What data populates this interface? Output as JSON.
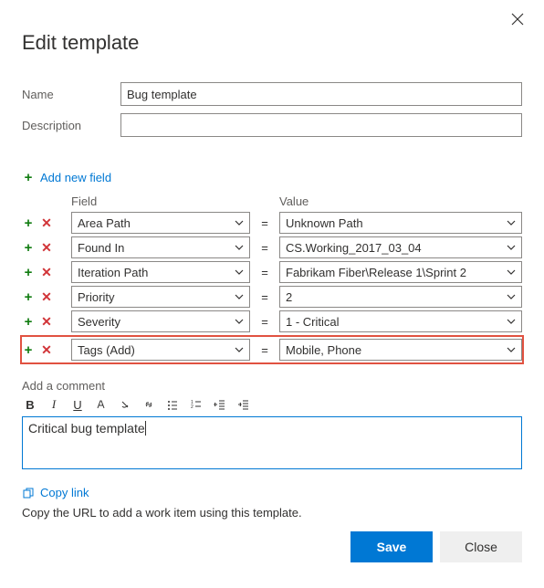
{
  "dialog": {
    "title": "Edit template",
    "nameLabel": "Name",
    "nameValue": "Bug template",
    "descLabel": "Description",
    "descValue": ""
  },
  "addFieldLabel": "Add new field",
  "headers": {
    "field": "Field",
    "value": "Value"
  },
  "rows": [
    {
      "field": "Area Path",
      "value": "Unknown Path",
      "highlighted": false
    },
    {
      "field": "Found In",
      "value": "CS.Working_2017_03_04",
      "highlighted": false
    },
    {
      "field": "Iteration Path",
      "value": "Fabrikam Fiber\\Release 1\\Sprint 2",
      "highlighted": false
    },
    {
      "field": "Priority",
      "value": "2",
      "highlighted": false
    },
    {
      "field": "Severity",
      "value": "1 - Critical",
      "highlighted": false
    },
    {
      "field": "Tags (Add)",
      "value": "Mobile, Phone",
      "highlighted": true
    }
  ],
  "comment": {
    "label": "Add a comment",
    "value": "Critical bug template"
  },
  "copyLink": {
    "label": "Copy link",
    "desc": "Copy the URL to add a work item using this template."
  },
  "buttons": {
    "save": "Save",
    "close": "Close"
  }
}
